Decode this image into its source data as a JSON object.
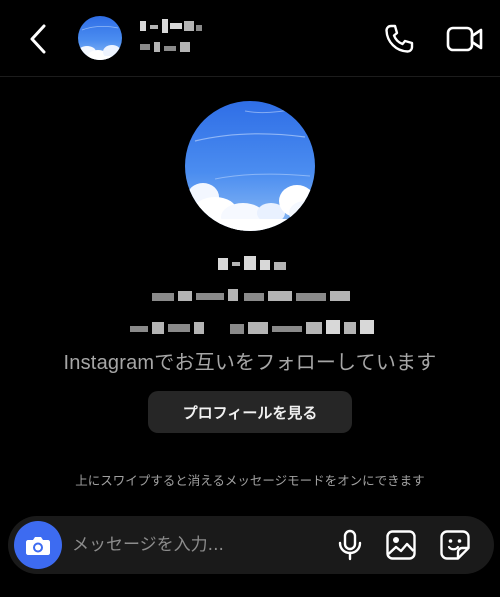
{
  "header": {
    "back_icon": "chevron-left-icon",
    "call_icon": "phone-icon",
    "video_icon": "video-camera-icon"
  },
  "profile": {
    "follow_status": "Instagramでお互いをフォローしています",
    "view_profile_label": "プロフィールを見る"
  },
  "chat": {
    "vanish_mode_hint": "上にスワイプすると消えるメッセージモードをオンにできます"
  },
  "composer": {
    "placeholder": "メッセージを入力...",
    "camera_icon": "camera-icon",
    "mic_icon": "microphone-icon",
    "gallery_icon": "image-icon",
    "sticker_icon": "sticker-icon"
  },
  "colors": {
    "background": "#000000",
    "accent": "#3d6bf1",
    "button_bg": "#262626",
    "composer_bg": "#1a1a1a",
    "secondary_text": "#a6a6a6"
  }
}
